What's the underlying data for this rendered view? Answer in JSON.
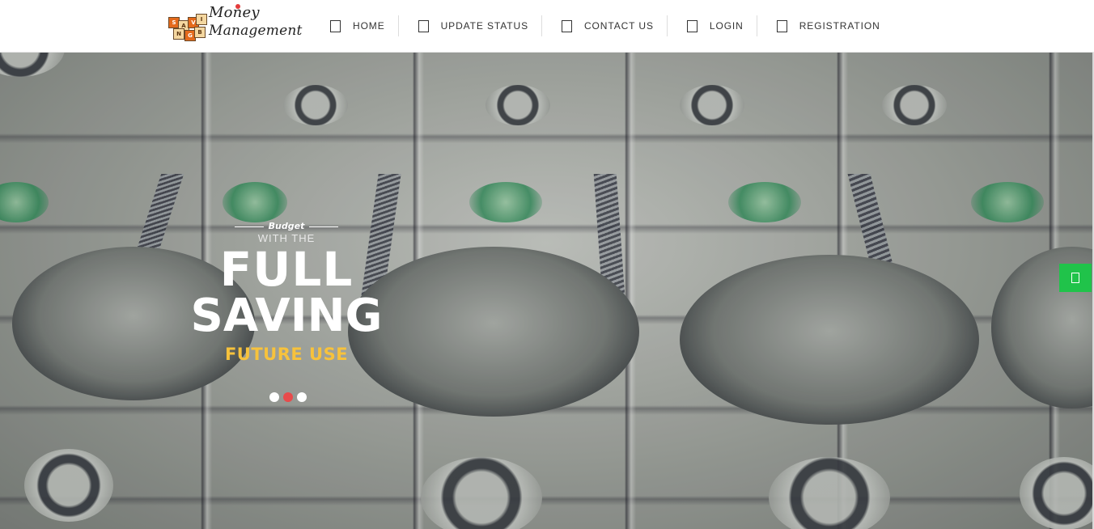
{
  "logo": {
    "line1": "Money",
    "line2": "Management",
    "tiles": [
      "S",
      "A",
      "V",
      "I",
      "N",
      "G",
      "B",
      "U",
      "D",
      "E",
      "T"
    ]
  },
  "nav": {
    "items": [
      {
        "label": "HOME",
        "icon": "square-icon"
      },
      {
        "label": "UPDATE STATUS",
        "icon": "square-icon"
      },
      {
        "label": "CONTACT US",
        "icon": "square-icon"
      },
      {
        "label": "LOGIN",
        "icon": "square-icon"
      },
      {
        "label": "REGISTRATION",
        "icon": "square-icon"
      }
    ]
  },
  "hero": {
    "budget": "Budget",
    "with": "WITH THE",
    "line1": "FULL",
    "line2": "SAVING",
    "line3": "FUTURE USE",
    "slides_total": 3,
    "active_slide": 2
  },
  "side_button": {
    "icon": "square-icon"
  },
  "colors": {
    "accent_red": "#e84b4b",
    "accent_yellow": "#f7c23c",
    "side_button_green": "#20c34a",
    "nav_text": "#333333"
  }
}
